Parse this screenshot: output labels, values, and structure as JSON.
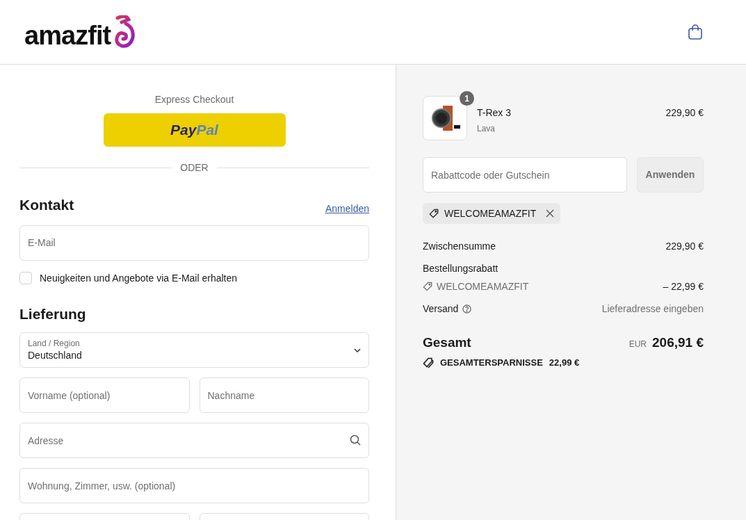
{
  "header": {
    "logo": "amazfit"
  },
  "express": {
    "title": "Express Checkout",
    "paypal": [
      "Pay",
      "Pal"
    ],
    "divider": "ODER"
  },
  "contact": {
    "title": "Kontakt",
    "login_link": "Anmelden",
    "email_placeholder": "E-Mail",
    "newsletter": {
      "label": "Neuigkeiten und Angebote via E-Mail erhalten",
      "checked": false
    }
  },
  "delivery": {
    "title": "Lieferung",
    "fields": [
      {
        "kind": "select",
        "label": "Land / Region",
        "value": "Deutschland"
      },
      {
        "kind": "pair",
        "placeholders": [
          "Vorname (optional)",
          "Nachname"
        ]
      },
      {
        "kind": "search",
        "placeholder": "Adresse"
      },
      {
        "kind": "text",
        "placeholder": "Wohnung, Zimmer, usw. (optional)"
      },
      {
        "kind": "pair_blank"
      }
    ]
  },
  "cart": {
    "items": [
      {
        "name": "T-Rex 3",
        "variant": "Lava",
        "price": "229,90 €",
        "quantity": "1"
      }
    ],
    "discount": {
      "placeholder": "Rabattcode oder Gutschein",
      "button": "Anwenden",
      "applied_code": "WELCOMEAMAZFIT"
    },
    "subtotal": {
      "label": "Zwischensumme",
      "value": "229,90 €"
    },
    "order_discount": {
      "label": "Bestellungsrabatt",
      "code": "WELCOMEAMAZFIT",
      "value": "– 22,99 €"
    },
    "shipping": {
      "label": "Versand",
      "value": "Lieferadresse eingeben"
    },
    "total": {
      "label": "Gesamt",
      "currency": "EUR",
      "value": "206,91 €"
    },
    "savings": {
      "label": "GESAMTERSPARNISSE",
      "value": "22,99 €"
    }
  }
}
